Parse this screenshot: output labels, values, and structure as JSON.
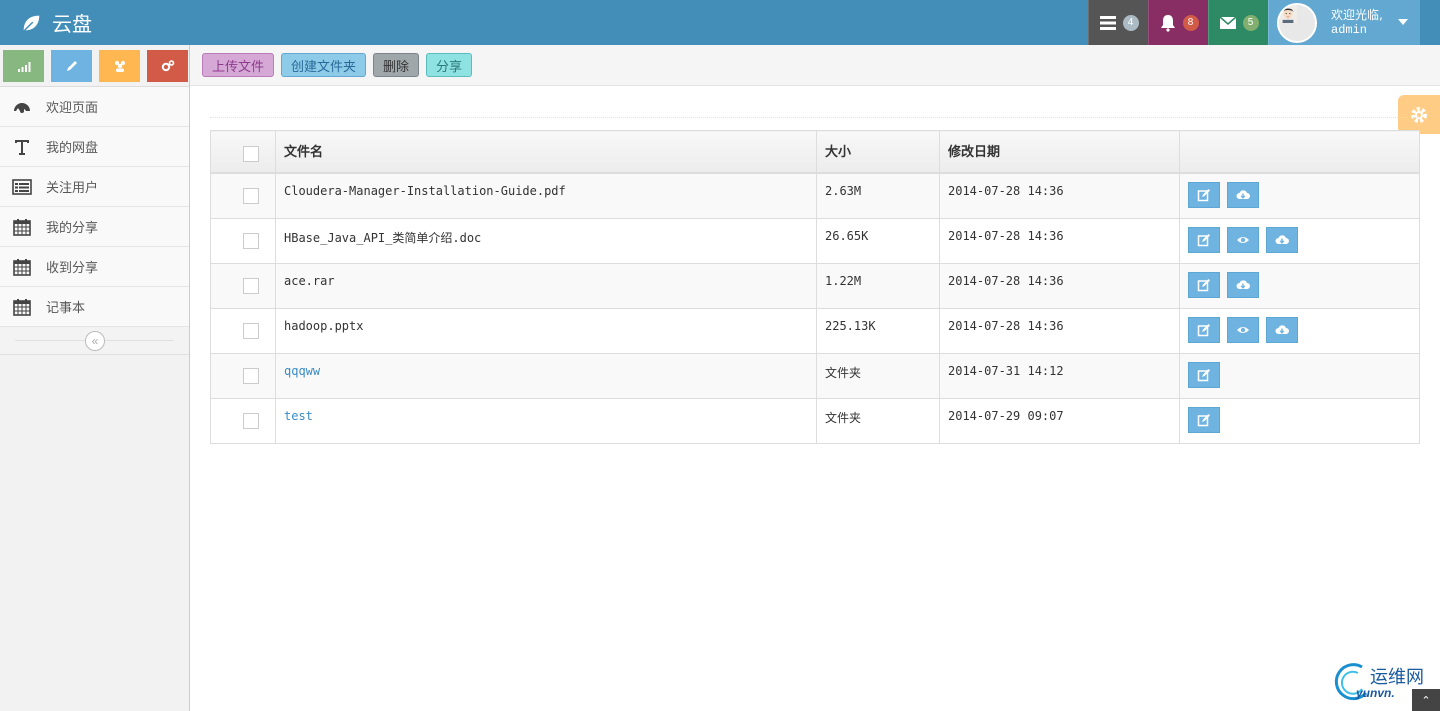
{
  "app": {
    "title": "云盘"
  },
  "nav": {
    "tasks_count": "4",
    "notifications_count": "8",
    "messages_count": "5",
    "user_greeting": "欢迎光临,",
    "user_name": "admin"
  },
  "sidebar": {
    "items": [
      {
        "label": "欢迎页面",
        "icon": "dashboard-icon"
      },
      {
        "label": "我的网盘",
        "icon": "text-icon"
      },
      {
        "label": "关注用户",
        "icon": "list-icon"
      },
      {
        "label": "我的分享",
        "icon": "calendar-icon"
      },
      {
        "label": "收到分享",
        "icon": "calendar-icon"
      },
      {
        "label": "记事本",
        "icon": "calendar-icon"
      }
    ]
  },
  "toolbar": {
    "upload_label": "上传文件",
    "create_folder_label": "创建文件夹",
    "delete_label": "删除",
    "share_label": "分享"
  },
  "table": {
    "headers": {
      "name": "文件名",
      "size": "大小",
      "date": "修改日期"
    },
    "rows": [
      {
        "name": "Cloudera-Manager-Installation-Guide.pdf",
        "size": "2.63M",
        "date": "2014-07-28 14:36",
        "is_folder": false,
        "actions": [
          "edit",
          "download"
        ]
      },
      {
        "name": "HBase_Java_API_类简单介绍.doc",
        "size": "26.65K",
        "date": "2014-07-28 14:36",
        "is_folder": false,
        "actions": [
          "edit",
          "view",
          "download"
        ]
      },
      {
        "name": "ace.rar",
        "size": "1.22M",
        "date": "2014-07-28 14:36",
        "is_folder": false,
        "actions": [
          "edit",
          "download"
        ]
      },
      {
        "name": "hadoop.pptx",
        "size": "225.13K",
        "date": "2014-07-28 14:36",
        "is_folder": false,
        "actions": [
          "edit",
          "view",
          "download"
        ]
      },
      {
        "name": "qqqww",
        "size": "文件夹",
        "date": "2014-07-31 14:12",
        "is_folder": true,
        "actions": [
          "edit"
        ]
      },
      {
        "name": "test",
        "size": "文件夹",
        "date": "2014-07-29 09:07",
        "is_folder": true,
        "actions": [
          "edit"
        ]
      }
    ]
  },
  "watermark": {
    "line1": "运维网",
    "line2": "yunvn."
  },
  "colors": {
    "navbar": "#438eb9",
    "action_button": "#6fb3e0",
    "folder_link": "#3b8bc4"
  }
}
